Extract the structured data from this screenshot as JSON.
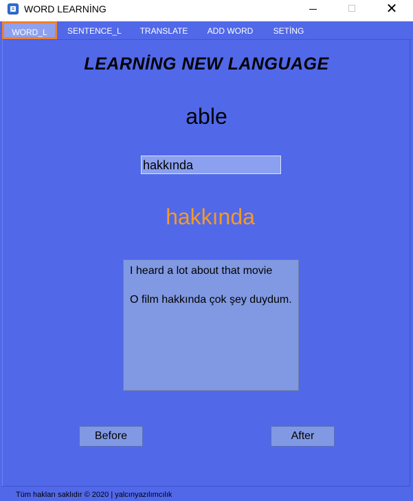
{
  "window": {
    "title": "WORD LEARNİNG",
    "min_label": "",
    "max_label": "",
    "close_label": "✕"
  },
  "tabs": [
    {
      "label": "WORD_L",
      "active": true
    },
    {
      "label": "SENTENCE_L",
      "active": false
    },
    {
      "label": "TRANSLATE",
      "active": false
    },
    {
      "label": "ADD WORD",
      "active": false
    },
    {
      "label": "SETİNG",
      "active": false
    }
  ],
  "main": {
    "heading": "LEARNİNG NEW LANGUAGE",
    "word": "able",
    "input_value": "hakkında",
    "translation": "hakkında",
    "sentence_en": "I heard a lot about that movie",
    "sentence_tr": "O film hakkında çok şey duydum."
  },
  "buttons": {
    "before_label": "Before",
    "after_label": "After"
  },
  "status": {
    "text": "Tüm hakları saklıdır © 2020 | yalcınyazılımcılık"
  },
  "colors": {
    "panel_bg": "#5168e9",
    "active_tab_border": "#f07f2d",
    "translation_text": "#f29a2a"
  }
}
